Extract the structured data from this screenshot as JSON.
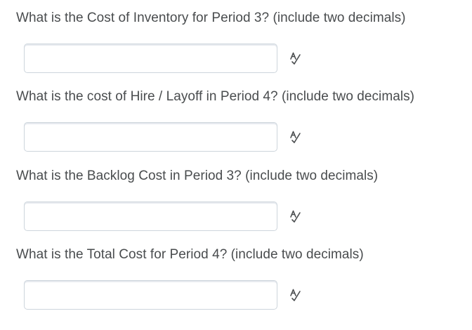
{
  "questions": [
    {
      "text": "What is the Cost of Inventory for Period 3? (include two decimals)",
      "value": ""
    },
    {
      "text": "What is the cost of Hire / Layoff in Period 4? (include two decimals)",
      "value": ""
    },
    {
      "text": "What is the Backlog Cost in Period 3? (include two decimals)",
      "value": ""
    },
    {
      "text": "What is the Total Cost for Period 4? (include two decimals)",
      "value": ""
    }
  ],
  "icons": {
    "spellcheck": "spellcheck-icon"
  },
  "colors": {
    "text": "#494c4e",
    "input_border": "#cdd5dc"
  }
}
